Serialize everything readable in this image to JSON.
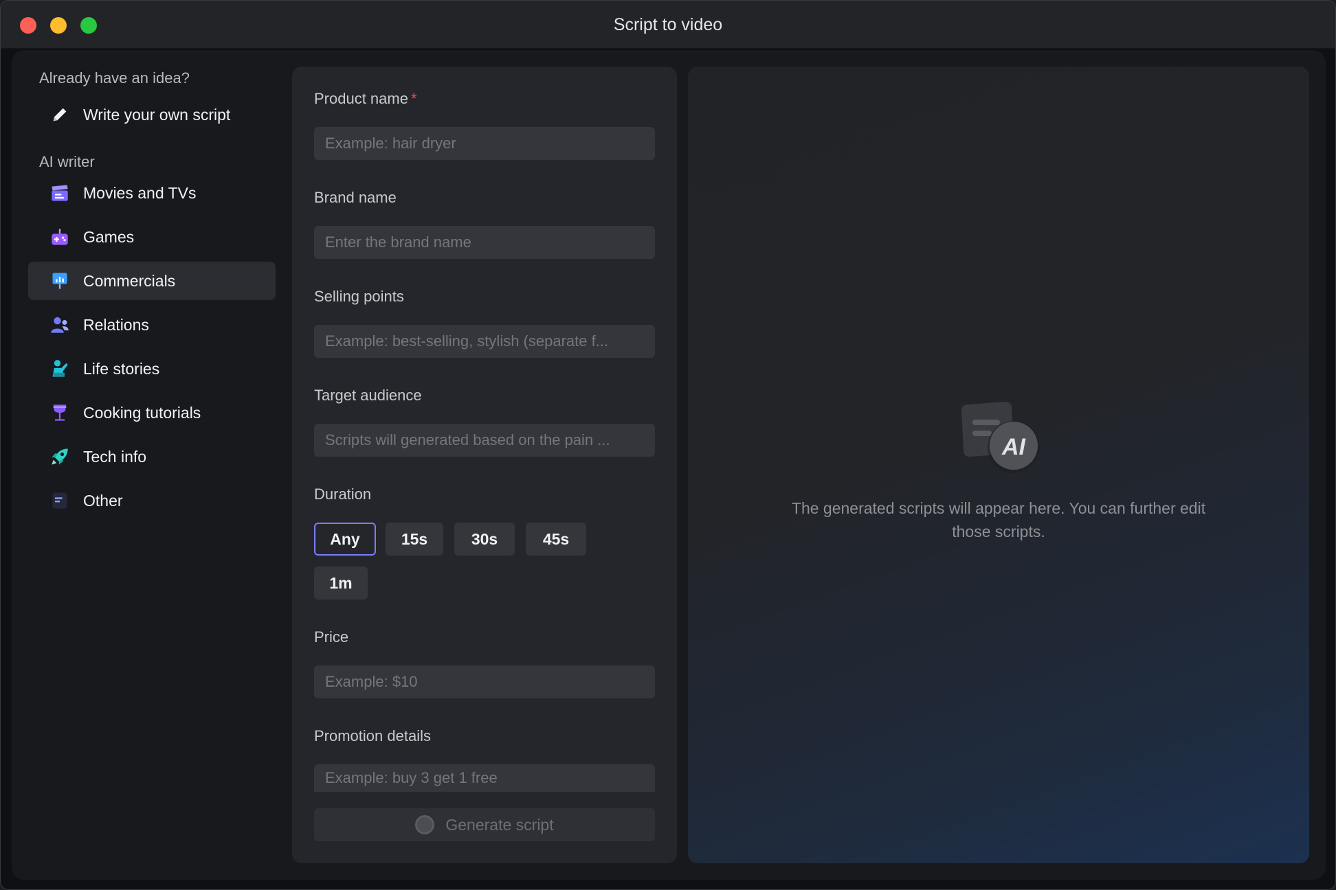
{
  "window": {
    "title": "Script to video"
  },
  "sidebar": {
    "own_section_label": "Already have an idea?",
    "write_own": {
      "label": "Write your own script",
      "icon": "pencil-icon"
    },
    "ai_section_label": "AI writer",
    "items": [
      {
        "label": "Movies and TVs",
        "icon": "clapperboard-icon",
        "color": "#7b6cff"
      },
      {
        "label": "Games",
        "icon": "gamepad-icon",
        "color": "#9b5cff"
      },
      {
        "label": "Commercials",
        "icon": "presentation-icon",
        "color": "#3aa0ff",
        "active": true
      },
      {
        "label": "Relations",
        "icon": "people-icon",
        "color": "#6e7bff"
      },
      {
        "label": "Life stories",
        "icon": "person-icon",
        "color": "#22c1d6"
      },
      {
        "label": "Cooking tutorials",
        "icon": "wine-glass-icon",
        "color": "#8a5cff"
      },
      {
        "label": "Tech info",
        "icon": "rocket-icon",
        "color": "#2fd1c4"
      },
      {
        "label": "Other",
        "icon": "list-icon",
        "color": "#6e8bff"
      }
    ]
  },
  "form": {
    "product_name": {
      "label": "Product name",
      "required_mark": "*",
      "placeholder": "Example: hair dryer",
      "value": ""
    },
    "brand_name": {
      "label": "Brand name",
      "placeholder": "Enter the brand name",
      "value": ""
    },
    "selling_points": {
      "label": "Selling points",
      "placeholder": "Example: best-selling, stylish (separate f...",
      "value": ""
    },
    "target_audience": {
      "label": "Target audience",
      "placeholder": "Scripts will generated based on the pain ...",
      "value": ""
    },
    "duration": {
      "label": "Duration",
      "options": [
        "Any",
        "15s",
        "30s",
        "45s",
        "1m"
      ],
      "selected": "Any"
    },
    "price": {
      "label": "Price",
      "placeholder": "Example: $10",
      "value": ""
    },
    "promotion": {
      "label": "Promotion details",
      "placeholder": "Example: buy 3 get 1 free",
      "value": ""
    },
    "generate_label": "Generate script"
  },
  "output": {
    "illustration_icon": "ai-document-icon",
    "illustration_text": "AI",
    "message": "The generated scripts will appear here. You can further edit those scripts."
  }
}
